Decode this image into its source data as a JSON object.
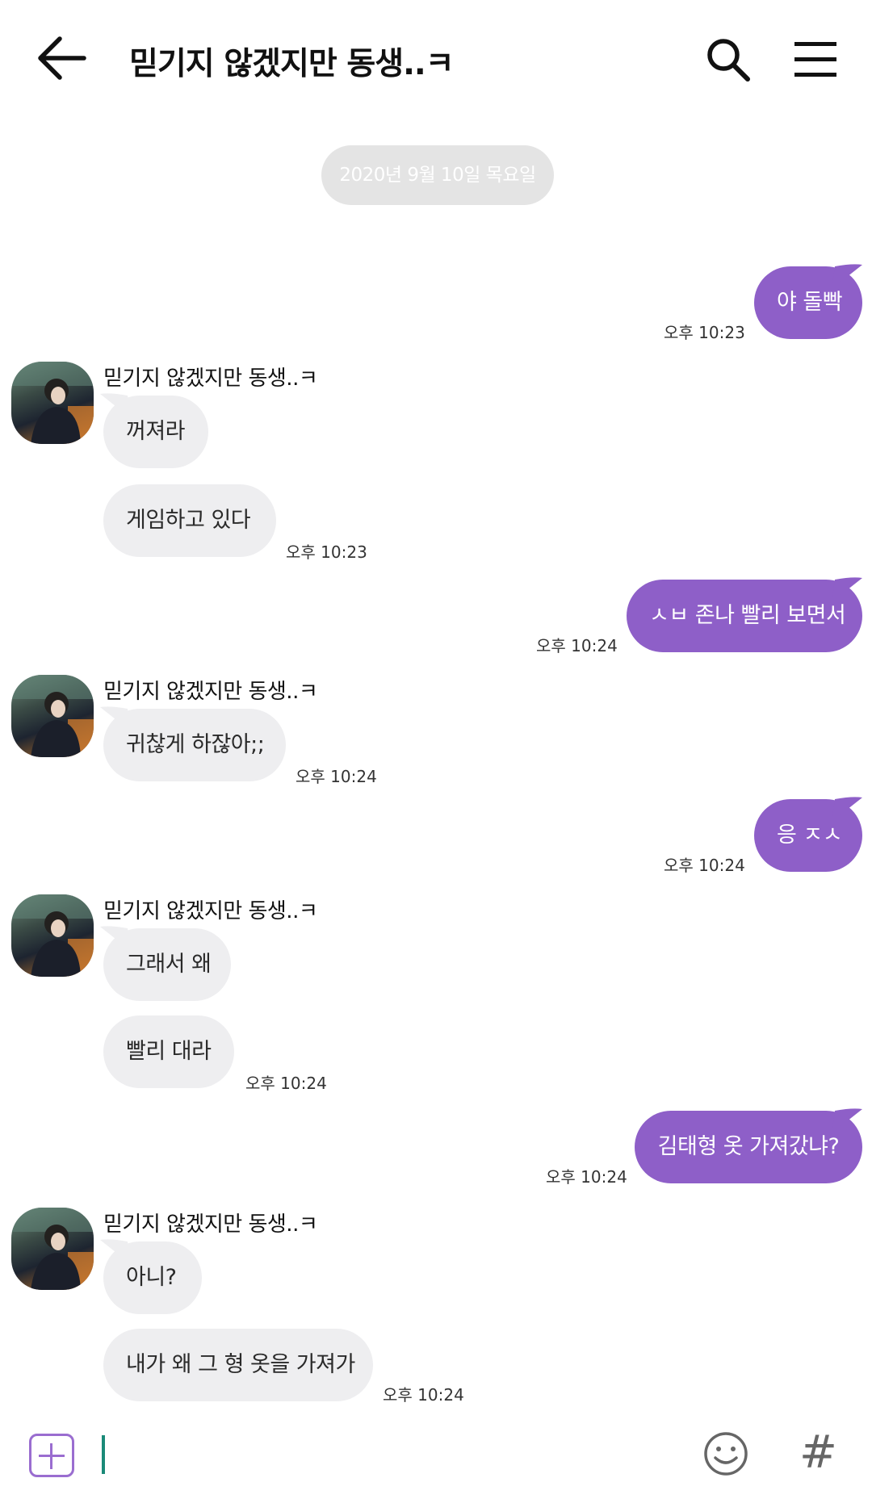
{
  "header": {
    "title": "믿기지 않겠지만 동생..ㅋ",
    "back_icon": "arrow-left-icon",
    "search_icon": "search-icon",
    "menu_icon": "hamburger-menu-icon"
  },
  "date_divider": "2020년 9월 10일 목요일",
  "contact_name": "믿기지 않겠지만 동생..ㅋ",
  "messages": [
    {
      "from": "me",
      "text": "야 돌빡",
      "time": "오후 10:23"
    },
    {
      "from": "other",
      "text": "꺼져라",
      "time": ""
    },
    {
      "from": "other",
      "text": "게임하고 있다",
      "time": "오후 10:23"
    },
    {
      "from": "me",
      "text": "ㅅㅂ 존나 빨리 보면서",
      "time": "오후 10:24"
    },
    {
      "from": "other",
      "text": "귀찮게 하잖아;;",
      "time": "오후 10:24"
    },
    {
      "from": "me",
      "text": "응 ㅈㅅ",
      "time": "오후 10:24"
    },
    {
      "from": "other",
      "text": "그래서 왜",
      "time": ""
    },
    {
      "from": "other",
      "text": "빨리 대라",
      "time": "오후 10:24"
    },
    {
      "from": "me",
      "text": "김태형 옷 가져갔냐?",
      "time": "오후 10:24"
    },
    {
      "from": "other",
      "text": "아니?",
      "time": ""
    },
    {
      "from": "other",
      "text": "내가 왜 그 형 옷을 가져가",
      "time": "오후 10:24"
    }
  ],
  "input_bar": {
    "value": "",
    "plus_icon": "plus-box-icon",
    "emoji_icon": "smiley-icon",
    "hash_label": "#"
  },
  "colors": {
    "outgoing_bubble": "#8e5fc8",
    "incoming_bubble": "#eeeef0",
    "accent": "#9a6dd0",
    "caret": "#1a8a78"
  }
}
